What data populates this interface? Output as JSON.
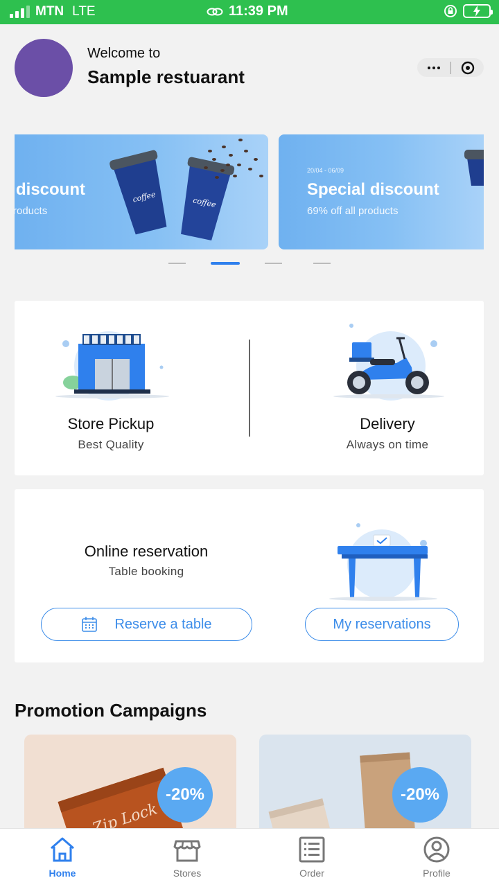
{
  "status_bar": {
    "carrier": "MTN",
    "network": "LTE",
    "time": "11:39 PM"
  },
  "header": {
    "welcome": "Welcome to",
    "restaurant_name": "Sample restuarant"
  },
  "banners": [
    {
      "date": "",
      "title": "discount",
      "subtitle": "roducts"
    },
    {
      "date": "20/04 - 06/09",
      "title": "Special discount",
      "subtitle": "69% off all products"
    }
  ],
  "carousel": {
    "count": 4,
    "active_index": 1
  },
  "services": {
    "pickup": {
      "title": "Store Pickup",
      "subtitle": "Best Quality"
    },
    "delivery": {
      "title": "Delivery",
      "subtitle": "Always on time"
    }
  },
  "reservation": {
    "title": "Online reservation",
    "subtitle": "Table booking",
    "reserve_label": "Reserve a table",
    "my_label": "My reservations"
  },
  "promotions": {
    "title": "Promotion Campaigns",
    "items": [
      {
        "badge": "-20%",
        "image_text": "Zip Lock"
      },
      {
        "badge": "-20%"
      }
    ]
  },
  "tabs": [
    {
      "label": "Home",
      "icon": "home-icon",
      "active": true
    },
    {
      "label": "Stores",
      "icon": "store-icon",
      "active": false
    },
    {
      "label": "Order",
      "icon": "order-list-icon",
      "active": false
    },
    {
      "label": "Profile",
      "icon": "profile-icon",
      "active": false
    }
  ],
  "colors": {
    "status_bar": "#2ec04f",
    "accent": "#2f80ed",
    "avatar": "#6b4fa7",
    "banner": "#86c0f4"
  }
}
